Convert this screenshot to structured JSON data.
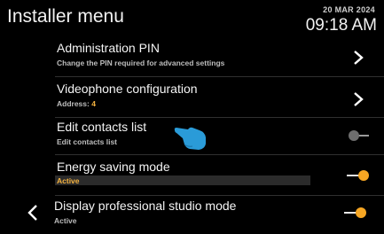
{
  "header": {
    "title": "Installer menu",
    "date": "20 MAR 2024",
    "time": "09:18 AM"
  },
  "rows": [
    {
      "label": "Administration PIN",
      "sub": "Change the PIN required for advanced settings",
      "control": "chevron"
    },
    {
      "label": "Videophone configuration",
      "sub_prefix": "Address:",
      "sub_value": "4",
      "control": "chevron"
    },
    {
      "label": "Edit contacts list",
      "sub": "Edit contacts list",
      "control": "toggle-off"
    },
    {
      "label": "Energy saving mode",
      "sub": "Active",
      "control": "toggle-on"
    },
    {
      "label": "Display professional studio mode",
      "sub": "Active",
      "control": "toggle-on"
    }
  ],
  "icons": {
    "back": "chevron-left-icon",
    "forward": "chevron-right-icon",
    "pointer": "hand-pointer-icon"
  },
  "colors": {
    "background": "#000000",
    "accent": "#f6a623",
    "pointer": "#2a9bd8"
  }
}
